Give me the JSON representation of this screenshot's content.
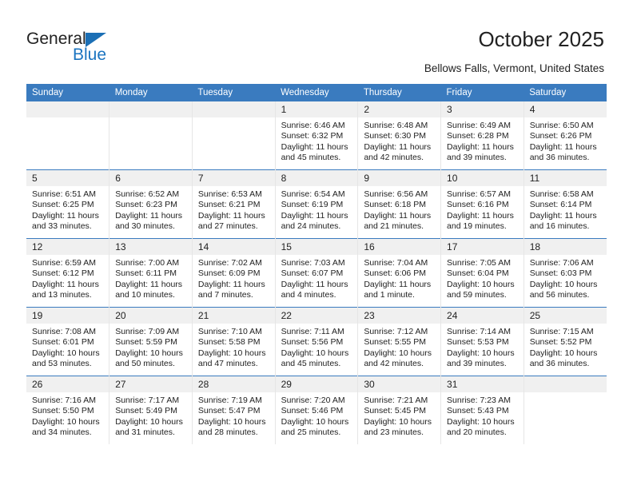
{
  "brand": {
    "name_top": "General",
    "name_bottom": "Blue",
    "triangle_color": "#1b6fb5",
    "text_color_top": "#222222",
    "text_color_bottom": "#1b74c0"
  },
  "header": {
    "title": "October 2025",
    "subtitle": "Bellows Falls, Vermont, United States"
  },
  "theme": {
    "header_row_bg": "#3a7bbf",
    "header_row_text": "#ffffff",
    "daynum_bg": "#f0f0f0",
    "cell_bg": "#ffffff",
    "grid_line": "#e6e6e6",
    "week_divider": "#3a7bbf"
  },
  "weekdays": [
    "Sunday",
    "Monday",
    "Tuesday",
    "Wednesday",
    "Thursday",
    "Friday",
    "Saturday"
  ],
  "labels": {
    "sunrise": "Sunrise:",
    "sunset": "Sunset:",
    "daylight": "Daylight:"
  },
  "weeks": [
    [
      {
        "day": "",
        "blank": true
      },
      {
        "day": "",
        "blank": true
      },
      {
        "day": "",
        "blank": true
      },
      {
        "day": "1",
        "sunrise": "Sunrise: 6:46 AM",
        "sunset": "Sunset: 6:32 PM",
        "daylight": "Daylight: 11 hours and 45 minutes."
      },
      {
        "day": "2",
        "sunrise": "Sunrise: 6:48 AM",
        "sunset": "Sunset: 6:30 PM",
        "daylight": "Daylight: 11 hours and 42 minutes."
      },
      {
        "day": "3",
        "sunrise": "Sunrise: 6:49 AM",
        "sunset": "Sunset: 6:28 PM",
        "daylight": "Daylight: 11 hours and 39 minutes."
      },
      {
        "day": "4",
        "sunrise": "Sunrise: 6:50 AM",
        "sunset": "Sunset: 6:26 PM",
        "daylight": "Daylight: 11 hours and 36 minutes."
      }
    ],
    [
      {
        "day": "5",
        "sunrise": "Sunrise: 6:51 AM",
        "sunset": "Sunset: 6:25 PM",
        "daylight": "Daylight: 11 hours and 33 minutes."
      },
      {
        "day": "6",
        "sunrise": "Sunrise: 6:52 AM",
        "sunset": "Sunset: 6:23 PM",
        "daylight": "Daylight: 11 hours and 30 minutes."
      },
      {
        "day": "7",
        "sunrise": "Sunrise: 6:53 AM",
        "sunset": "Sunset: 6:21 PM",
        "daylight": "Daylight: 11 hours and 27 minutes."
      },
      {
        "day": "8",
        "sunrise": "Sunrise: 6:54 AM",
        "sunset": "Sunset: 6:19 PM",
        "daylight": "Daylight: 11 hours and 24 minutes."
      },
      {
        "day": "9",
        "sunrise": "Sunrise: 6:56 AM",
        "sunset": "Sunset: 6:18 PM",
        "daylight": "Daylight: 11 hours and 21 minutes."
      },
      {
        "day": "10",
        "sunrise": "Sunrise: 6:57 AM",
        "sunset": "Sunset: 6:16 PM",
        "daylight": "Daylight: 11 hours and 19 minutes."
      },
      {
        "day": "11",
        "sunrise": "Sunrise: 6:58 AM",
        "sunset": "Sunset: 6:14 PM",
        "daylight": "Daylight: 11 hours and 16 minutes."
      }
    ],
    [
      {
        "day": "12",
        "sunrise": "Sunrise: 6:59 AM",
        "sunset": "Sunset: 6:12 PM",
        "daylight": "Daylight: 11 hours and 13 minutes."
      },
      {
        "day": "13",
        "sunrise": "Sunrise: 7:00 AM",
        "sunset": "Sunset: 6:11 PM",
        "daylight": "Daylight: 11 hours and 10 minutes."
      },
      {
        "day": "14",
        "sunrise": "Sunrise: 7:02 AM",
        "sunset": "Sunset: 6:09 PM",
        "daylight": "Daylight: 11 hours and 7 minutes."
      },
      {
        "day": "15",
        "sunrise": "Sunrise: 7:03 AM",
        "sunset": "Sunset: 6:07 PM",
        "daylight": "Daylight: 11 hours and 4 minutes."
      },
      {
        "day": "16",
        "sunrise": "Sunrise: 7:04 AM",
        "sunset": "Sunset: 6:06 PM",
        "daylight": "Daylight: 11 hours and 1 minute."
      },
      {
        "day": "17",
        "sunrise": "Sunrise: 7:05 AM",
        "sunset": "Sunset: 6:04 PM",
        "daylight": "Daylight: 10 hours and 59 minutes."
      },
      {
        "day": "18",
        "sunrise": "Sunrise: 7:06 AM",
        "sunset": "Sunset: 6:03 PM",
        "daylight": "Daylight: 10 hours and 56 minutes."
      }
    ],
    [
      {
        "day": "19",
        "sunrise": "Sunrise: 7:08 AM",
        "sunset": "Sunset: 6:01 PM",
        "daylight": "Daylight: 10 hours and 53 minutes."
      },
      {
        "day": "20",
        "sunrise": "Sunrise: 7:09 AM",
        "sunset": "Sunset: 5:59 PM",
        "daylight": "Daylight: 10 hours and 50 minutes."
      },
      {
        "day": "21",
        "sunrise": "Sunrise: 7:10 AM",
        "sunset": "Sunset: 5:58 PM",
        "daylight": "Daylight: 10 hours and 47 minutes."
      },
      {
        "day": "22",
        "sunrise": "Sunrise: 7:11 AM",
        "sunset": "Sunset: 5:56 PM",
        "daylight": "Daylight: 10 hours and 45 minutes."
      },
      {
        "day": "23",
        "sunrise": "Sunrise: 7:12 AM",
        "sunset": "Sunset: 5:55 PM",
        "daylight": "Daylight: 10 hours and 42 minutes."
      },
      {
        "day": "24",
        "sunrise": "Sunrise: 7:14 AM",
        "sunset": "Sunset: 5:53 PM",
        "daylight": "Daylight: 10 hours and 39 minutes."
      },
      {
        "day": "25",
        "sunrise": "Sunrise: 7:15 AM",
        "sunset": "Sunset: 5:52 PM",
        "daylight": "Daylight: 10 hours and 36 minutes."
      }
    ],
    [
      {
        "day": "26",
        "sunrise": "Sunrise: 7:16 AM",
        "sunset": "Sunset: 5:50 PM",
        "daylight": "Daylight: 10 hours and 34 minutes."
      },
      {
        "day": "27",
        "sunrise": "Sunrise: 7:17 AM",
        "sunset": "Sunset: 5:49 PM",
        "daylight": "Daylight: 10 hours and 31 minutes."
      },
      {
        "day": "28",
        "sunrise": "Sunrise: 7:19 AM",
        "sunset": "Sunset: 5:47 PM",
        "daylight": "Daylight: 10 hours and 28 minutes."
      },
      {
        "day": "29",
        "sunrise": "Sunrise: 7:20 AM",
        "sunset": "Sunset: 5:46 PM",
        "daylight": "Daylight: 10 hours and 25 minutes."
      },
      {
        "day": "30",
        "sunrise": "Sunrise: 7:21 AM",
        "sunset": "Sunset: 5:45 PM",
        "daylight": "Daylight: 10 hours and 23 minutes."
      },
      {
        "day": "31",
        "sunrise": "Sunrise: 7:23 AM",
        "sunset": "Sunset: 5:43 PM",
        "daylight": "Daylight: 10 hours and 20 minutes."
      },
      {
        "day": "",
        "blank": true
      }
    ]
  ]
}
